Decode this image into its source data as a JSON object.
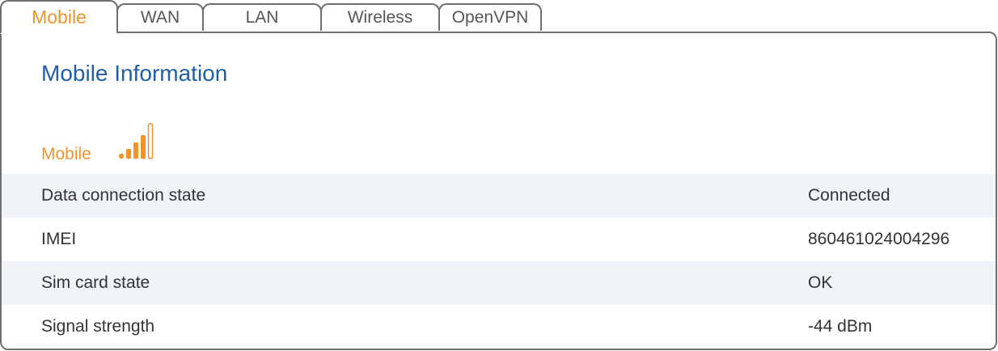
{
  "tabs": [
    {
      "label": "Mobile",
      "active": true
    },
    {
      "label": "WAN",
      "active": false
    },
    {
      "label": "LAN",
      "active": false
    },
    {
      "label": "Wireless",
      "active": false
    },
    {
      "label": "OpenVPN",
      "active": false
    }
  ],
  "panel": {
    "title": "Mobile Information",
    "section_label": "Mobile",
    "signal_icon": "signal-bars-icon",
    "signal_bars_filled": 4,
    "signal_bars_total": 5
  },
  "rows": [
    {
      "label": "Data connection state",
      "value": "Connected"
    },
    {
      "label": "IMEI",
      "value": "860461024004296"
    },
    {
      "label": "Sim card state",
      "value": "OK"
    },
    {
      "label": "Signal strength",
      "value": "-44 dBm"
    }
  ],
  "colors": {
    "accent": "#f0932b",
    "title": "#1e5fa8",
    "row_shade": "#f0f3f8",
    "border": "#6f6f6f"
  }
}
